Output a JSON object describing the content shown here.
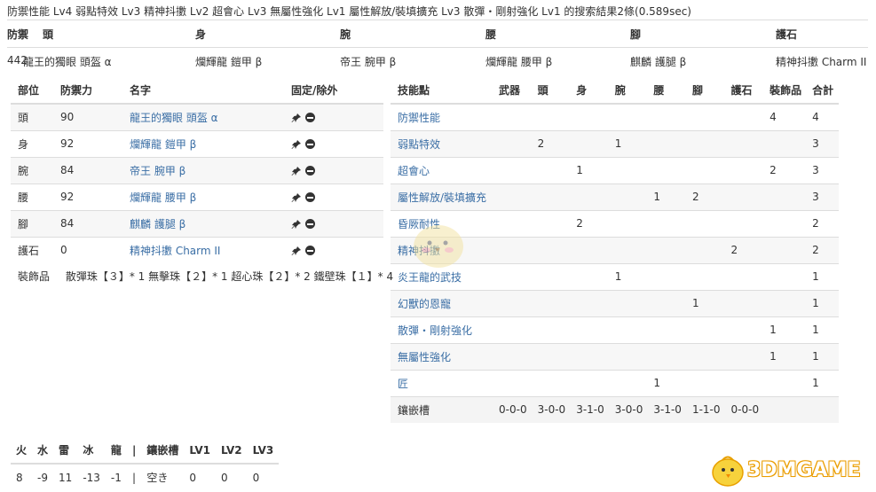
{
  "header": "防禦性能 Lv4 弱點特效 Lv3 精神抖擻 Lv2 超會心 Lv3 無屬性強化 Lv1 屬性解放/裝填擴充 Lv3 散彈・剛射強化 Lv1 的搜索結果2條(0.589sec)",
  "summary": {
    "headers": [
      "防禦",
      "頭",
      "身",
      "腕",
      "腰",
      "腳",
      "護石"
    ],
    "row": [
      "442",
      "龍王的獨眼 頭盔 α",
      "爛輝龍 鎧甲 β",
      "帝王 腕甲 β",
      "爛輝龍 腰甲 β",
      "麒麟 護腿 β",
      "精神抖擻 Charm II"
    ]
  },
  "equip": {
    "headers": [
      "部位",
      "防禦力",
      "名字",
      "固定/除外"
    ],
    "rows": [
      {
        "part": "頭",
        "def": "90",
        "name": "龍王的獨眼 頭盔 α"
      },
      {
        "part": "身",
        "def": "92",
        "name": "爛輝龍 鎧甲 β"
      },
      {
        "part": "腕",
        "def": "84",
        "name": "帝王 腕甲 β"
      },
      {
        "part": "腰",
        "def": "92",
        "name": "爛輝龍 腰甲 β"
      },
      {
        "part": "腳",
        "def": "84",
        "name": "麒麟 護腿 β"
      },
      {
        "part": "護石",
        "def": "0",
        "name": "精神抖擻 Charm II"
      }
    ],
    "deco_label": "裝飾品",
    "deco_text": "散彈珠【３】* 1 無擊珠【２】* 1 超心珠【２】* 2 鐵壁珠【１】* 4"
  },
  "skills": {
    "headers": [
      "技能點",
      "武器",
      "頭",
      "身",
      "腕",
      "腰",
      "腳",
      "護石",
      "裝飾品",
      "合計"
    ],
    "rows": [
      [
        "防禦性能",
        "",
        "",
        "",
        "",
        "",
        "",
        "",
        "4",
        "4"
      ],
      [
        "弱點特效",
        "",
        "2",
        "",
        "1",
        "",
        "",
        "",
        "",
        "3"
      ],
      [
        "超會心",
        "",
        "",
        "1",
        "",
        "",
        "",
        "",
        "2",
        "3"
      ],
      [
        "屬性解放/裝填擴充",
        "",
        "",
        "",
        "",
        "1",
        "2",
        "",
        "",
        "3"
      ],
      [
        "昏厥耐性",
        "",
        "",
        "2",
        "",
        "",
        "",
        "",
        "",
        "2"
      ],
      [
        "精神抖擻",
        "",
        "",
        "",
        "",
        "",
        "",
        "2",
        "",
        "2"
      ],
      [
        "炎王龍的武技",
        "",
        "",
        "",
        "1",
        "",
        "",
        "",
        "",
        "1"
      ],
      [
        "幻獸的恩寵",
        "",
        "",
        "",
        "",
        "",
        "1",
        "",
        "",
        "1"
      ],
      [
        "散彈・剛射強化",
        "",
        "",
        "",
        "",
        "",
        "",
        "",
        "1",
        "1"
      ],
      [
        "無屬性強化",
        "",
        "",
        "",
        "",
        "",
        "",
        "",
        "1",
        "1"
      ],
      [
        "匠",
        "",
        "",
        "",
        "",
        "1",
        "",
        "",
        "",
        "1"
      ]
    ],
    "slots_label": "鑲嵌槽",
    "slots": [
      "0-0-0",
      "3-0-0",
      "3-1-0",
      "3-0-0",
      "3-1-0",
      "1-1-0",
      "0-0-0"
    ]
  },
  "resist": {
    "headers": [
      "火",
      "水",
      "雷",
      "冰",
      "龍",
      "|",
      "鑲嵌槽",
      "LV1",
      "LV2",
      "LV3"
    ],
    "values": [
      "8",
      "-9",
      "11",
      "-13",
      "-1",
      "|",
      "空き",
      "0",
      "0",
      "0"
    ]
  },
  "watermark": "3DMGAME",
  "colors": {
    "link": "#3a6ea5",
    "border": "#dddddd",
    "logo_orange": "#f0a500"
  }
}
